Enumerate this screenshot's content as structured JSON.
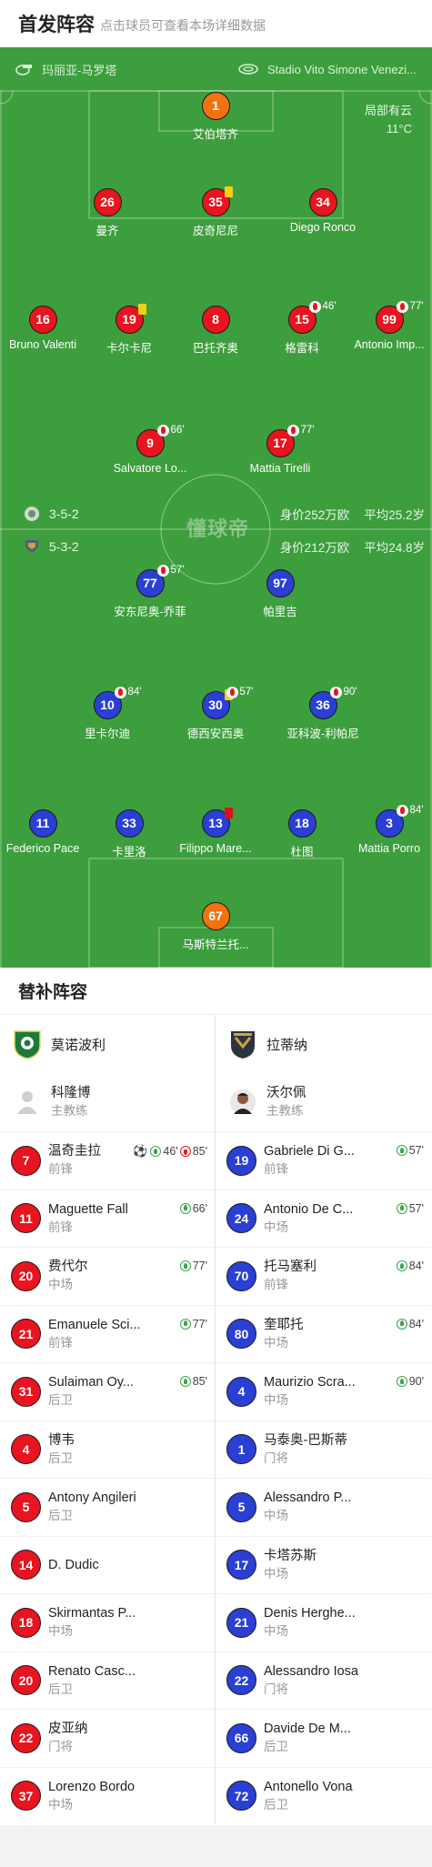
{
  "header": {
    "title": "首发阵容",
    "subtitle": "点击球员可查看本场详细数据"
  },
  "venue": {
    "referee": "玛丽亚-马罗塔",
    "stadium": "Stadio Vito Simone Venezi..."
  },
  "weather": {
    "text": "局部有云",
    "temp": "11°C"
  },
  "formations": {
    "home": {
      "formation": "3-5-2",
      "value": "身价252万欧",
      "age": "平均25.2岁"
    },
    "away": {
      "formation": "5-3-2",
      "value": "身价212万欧",
      "age": "平均24.8岁"
    }
  },
  "watermark": "懂球帝",
  "home_players": [
    {
      "num": "1",
      "name": "艾伯塔齐",
      "color": "#f07310"
    },
    {
      "num": "26",
      "name": "曼齐",
      "color": "#e8141f"
    },
    {
      "num": "35",
      "name": "皮奇尼尼",
      "color": "#e8141f",
      "card": "yellow"
    },
    {
      "num": "34",
      "name": "Diego Ronco",
      "color": "#e8141f"
    },
    {
      "num": "16",
      "name": "Bruno Valenti",
      "color": "#e8141f"
    },
    {
      "num": "19",
      "name": "卡尔卡尼",
      "color": "#e8141f",
      "card": "yellow"
    },
    {
      "num": "8",
      "name": "巴托齐奥",
      "color": "#e8141f"
    },
    {
      "num": "15",
      "name": "格雷科",
      "color": "#e8141f",
      "sub": "46'"
    },
    {
      "num": "99",
      "name": "Antonio Imp...",
      "color": "#e8141f",
      "sub": "77'"
    },
    {
      "num": "9",
      "name": "Salvatore Lo...",
      "color": "#e8141f",
      "sub": "66'"
    },
    {
      "num": "17",
      "name": "Mattia Tirelli",
      "color": "#e8141f",
      "sub": "77'"
    }
  ],
  "away_players": [
    {
      "num": "77",
      "name": "安东尼奥-乔菲",
      "color": "#2a3fd4",
      "sub": "57'"
    },
    {
      "num": "97",
      "name": "帕里吉",
      "color": "#2a3fd4"
    },
    {
      "num": "10",
      "name": "里卡尔迪",
      "color": "#2a3fd4",
      "sub": "84'"
    },
    {
      "num": "30",
      "name": "德西安西奥",
      "color": "#2a3fd4",
      "card": "yellow",
      "sub": "57'"
    },
    {
      "num": "36",
      "name": "亚科波-利帕尼",
      "color": "#2a3fd4",
      "sub": "90'"
    },
    {
      "num": "11",
      "name": "Federico Pace",
      "color": "#2a3fd4"
    },
    {
      "num": "33",
      "name": "卡里洛",
      "color": "#2a3fd4"
    },
    {
      "num": "13",
      "name": "Filippo Mare...",
      "color": "#2a3fd4",
      "card": "red"
    },
    {
      "num": "18",
      "name": "杜图",
      "color": "#2a3fd4"
    },
    {
      "num": "3",
      "name": "Mattia Porro",
      "color": "#2a3fd4",
      "sub": "84'"
    },
    {
      "num": "67",
      "name": "马斯特兰托...",
      "color": "#f07310"
    }
  ],
  "subs": {
    "title": "替补阵容",
    "home": {
      "team": "莫诺波利",
      "coach": {
        "name": "科隆博",
        "role": "主教练"
      },
      "players": [
        {
          "num": "7",
          "name": "温奇圭拉",
          "pos": "前锋",
          "goal": "⚽",
          "in": "46'",
          "out": "85'"
        },
        {
          "num": "11",
          "name": "Maguette Fall",
          "pos": "前锋",
          "in": "66'"
        },
        {
          "num": "20",
          "name": "费代尔",
          "pos": "中场",
          "in": "77'"
        },
        {
          "num": "21",
          "name": "Emanuele Sci...",
          "pos": "前锋",
          "in": "77'"
        },
        {
          "num": "31",
          "name": "Sulaiman Oy...",
          "pos": "后卫",
          "in": "85'"
        },
        {
          "num": "4",
          "name": "博韦",
          "pos": "后卫"
        },
        {
          "num": "5",
          "name": "Antony Angileri",
          "pos": "后卫"
        },
        {
          "num": "14",
          "name": "D. Dudic",
          "pos": ""
        },
        {
          "num": "18",
          "name": "Skirmantas P...",
          "pos": "中场"
        },
        {
          "num": "20",
          "name": "Renato Casc...",
          "pos": "后卫"
        },
        {
          "num": "22",
          "name": "皮亚纳",
          "pos": "门将"
        },
        {
          "num": "37",
          "name": "Lorenzo Bordo",
          "pos": "中场"
        }
      ]
    },
    "away": {
      "team": "拉蒂纳",
      "coach": {
        "name": "沃尔佩",
        "role": "主教练"
      },
      "players": [
        {
          "num": "19",
          "name": "Gabriele Di G...",
          "pos": "前锋",
          "in": "57'"
        },
        {
          "num": "24",
          "name": "Antonio De C...",
          "pos": "中场",
          "in": "57'"
        },
        {
          "num": "70",
          "name": "托马塞利",
          "pos": "前锋",
          "in": "84'"
        },
        {
          "num": "80",
          "name": "奎耶托",
          "pos": "中场",
          "in": "84'"
        },
        {
          "num": "4",
          "name": "Maurizio Scra...",
          "pos": "中场",
          "in": "90'"
        },
        {
          "num": "1",
          "name": "马泰奥-巴斯蒂",
          "pos": "门将"
        },
        {
          "num": "5",
          "name": "Alessandro P...",
          "pos": "中场"
        },
        {
          "num": "17",
          "name": "卡塔苏斯",
          "pos": "中场"
        },
        {
          "num": "21",
          "name": "Denis Herghe...",
          "pos": "中场"
        },
        {
          "num": "22",
          "name": "Alessandro Iosa",
          "pos": "门将"
        },
        {
          "num": "66",
          "name": "Davide De M...",
          "pos": "后卫"
        },
        {
          "num": "72",
          "name": "Antonello Vona",
          "pos": "后卫"
        }
      ]
    }
  }
}
